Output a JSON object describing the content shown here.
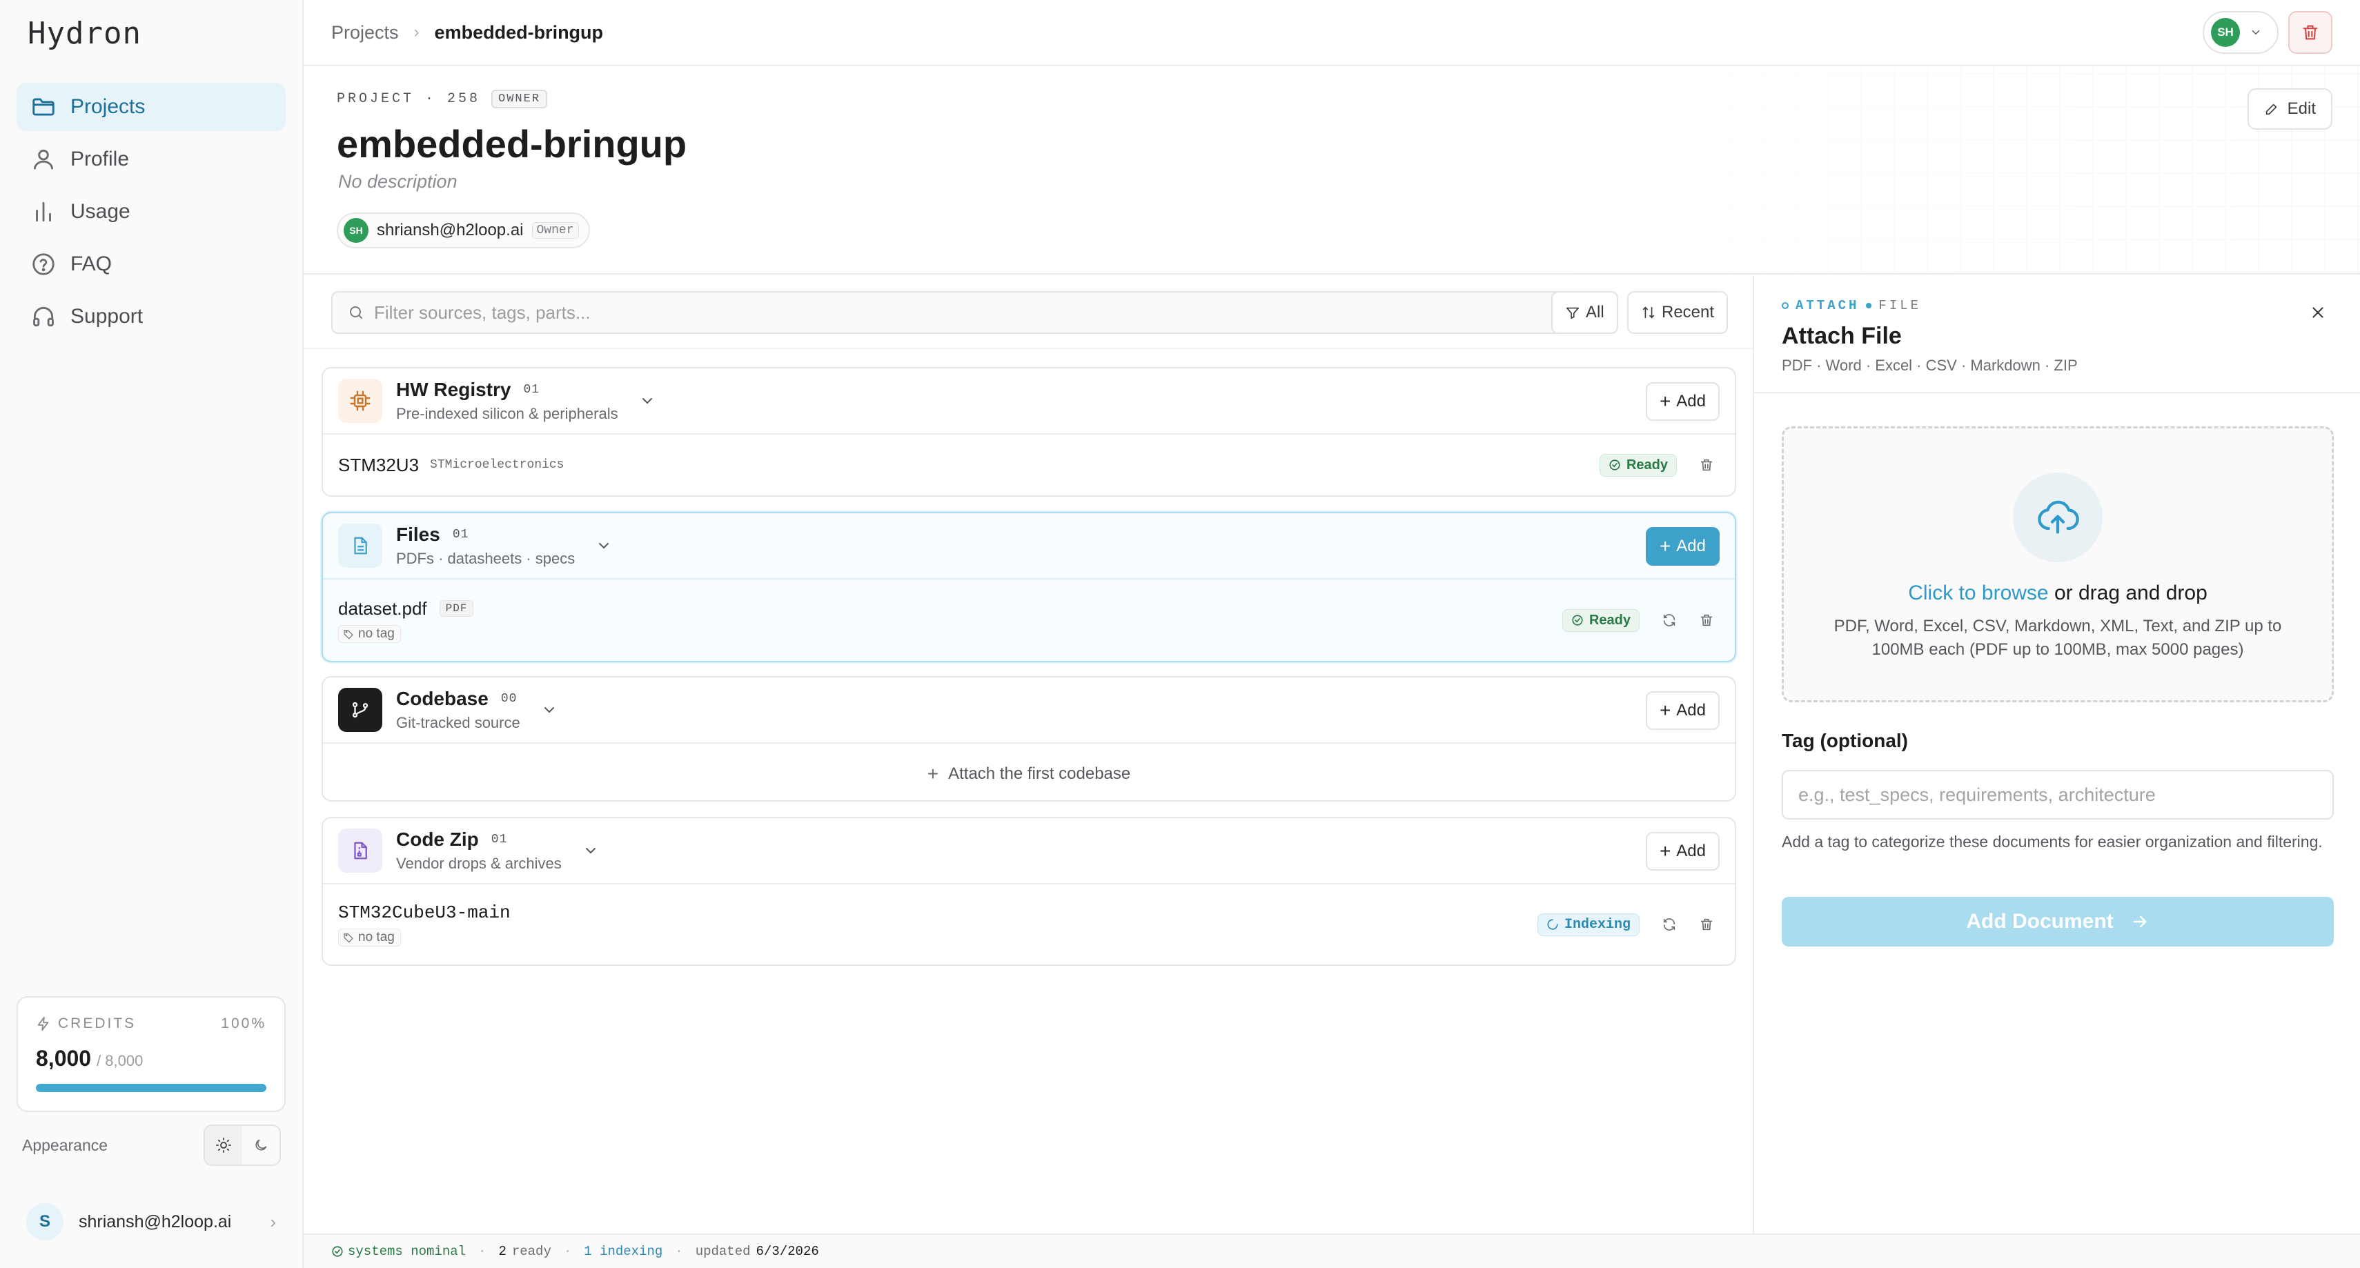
{
  "app": {
    "logo": "Hydron"
  },
  "sidebar": {
    "items": [
      {
        "label": "Projects",
        "icon": "folder-icon",
        "active": true
      },
      {
        "label": "Profile",
        "icon": "user-icon"
      },
      {
        "label": "Usage",
        "icon": "bar-chart-icon"
      },
      {
        "label": "FAQ",
        "icon": "help-circle-icon"
      },
      {
        "label": "Support",
        "icon": "headphones-icon"
      }
    ],
    "credits": {
      "label": "CREDITS",
      "percent": "100%",
      "value": "8,000",
      "total": "/ 8,000",
      "fill_fraction": 1.0
    },
    "appearance": {
      "label": "Appearance",
      "mode": "light"
    },
    "user": {
      "initial": "S",
      "email": "shriansh@h2loop.ai"
    }
  },
  "topbar": {
    "crumb_root": "Projects",
    "crumb_current": "embedded-bringup",
    "user_initials": "SH"
  },
  "project": {
    "meta": "PROJECT · 258",
    "role_chip": "OWNER",
    "title": "embedded-bringup",
    "description": "No description",
    "member_initials": "SH",
    "member_email": "shriansh@h2loop.ai",
    "member_role": "Owner",
    "edit_label": "Edit"
  },
  "filter": {
    "placeholder": "Filter sources, tags, parts...",
    "all_label": "All",
    "recent_label": "Recent"
  },
  "sections": {
    "hw": {
      "title": "HW Registry",
      "count": "01",
      "subtitle": "Pre-indexed silicon & peripherals",
      "add": "Add",
      "rows": [
        {
          "name": "STM32U3",
          "vendor": "STMicroelectronics",
          "status": "Ready"
        }
      ]
    },
    "files": {
      "title": "Files",
      "count": "01",
      "subtitle": "PDFs · datasheets · specs",
      "add": "Add",
      "rows": [
        {
          "name": "dataset.pdf",
          "type": "PDF",
          "tag": "no tag",
          "status": "Ready"
        }
      ]
    },
    "codebase": {
      "title": "Codebase",
      "count": "00",
      "subtitle": "Git-tracked source",
      "add": "Add",
      "empty": "Attach the first codebase"
    },
    "codezip": {
      "title": "Code Zip",
      "count": "01",
      "subtitle": "Vendor drops & archives",
      "add": "Add",
      "rows": [
        {
          "name": "STM32CubeU3-main",
          "tag": "no tag",
          "status": "Indexing"
        }
      ]
    }
  },
  "panel": {
    "kicker_a": "ATTACH",
    "kicker_b": "FILE",
    "title": "Attach File",
    "subtitle": "PDF · Word · Excel · CSV · Markdown · ZIP",
    "dz_link": "Click to browse",
    "dz_rest": " or drag and drop",
    "dz_sub": "PDF, Word, Excel, CSV, Markdown, XML, Text, and ZIP up to 100MB each (PDF up to 100MB, max 5000 pages)",
    "tag_label": "Tag (optional)",
    "tag_placeholder": "e.g., test_specs, requirements, architecture",
    "tag_help": "Add a tag to categorize these documents for easier organization and filtering.",
    "submit": "Add Document"
  },
  "statusbar": {
    "nominal": "systems nominal",
    "ready_count": "2",
    "ready_label": "ready",
    "indexing": "1 indexing",
    "updated_label": "updated",
    "updated_date": "6/3/2026"
  },
  "colors": {
    "accent": "#3ea1c9",
    "ready": "#2a7a45",
    "danger": "#d64545"
  }
}
